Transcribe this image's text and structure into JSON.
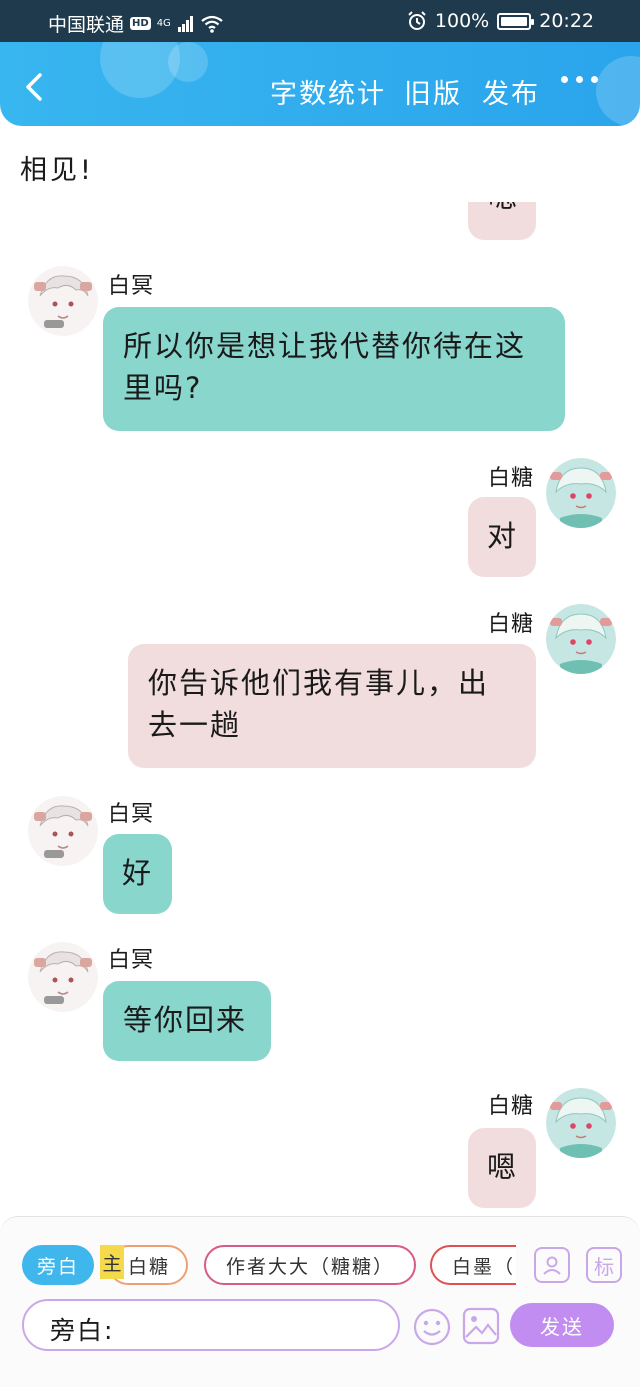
{
  "status_bar": {
    "carrier": "中国联通",
    "hd": "HD",
    "network": "4G",
    "battery": "100%",
    "battery_level": 1.0,
    "time": "20:22"
  },
  "header": {
    "word_count": "字数统计",
    "old_version": "旧版",
    "publish": "发布"
  },
  "chat": {
    "narration": "相见!",
    "partial_bubble": "嗯",
    "messages": [
      {
        "sender": "白冥",
        "text": "所以你是想让我代替你待在这里吗?",
        "side": "left"
      },
      {
        "sender": "白糖",
        "text": "对",
        "side": "right"
      },
      {
        "sender": "白糖",
        "text": "你告诉他们我有事儿，出去一趟",
        "side": "right"
      },
      {
        "sender": "白冥",
        "text": "好",
        "side": "left"
      },
      {
        "sender": "白冥",
        "text": "等你回来",
        "side": "left"
      },
      {
        "sender": "白糖",
        "text": "嗯",
        "side": "right"
      }
    ]
  },
  "panel": {
    "roles": [
      "旁白",
      "白糖",
      "作者大大（糖糖）",
      "白墨（"
    ],
    "owner_tag": "主",
    "role_icon": "person-icon",
    "tag_button": "标",
    "input_value": "旁白:",
    "send": "发送"
  },
  "colors": {
    "header_blue": "#2aa4ec",
    "teal_bubble": "#89d6cd",
    "pink_bubble": "#f1dddd",
    "accent_purple": "#c18df0"
  }
}
